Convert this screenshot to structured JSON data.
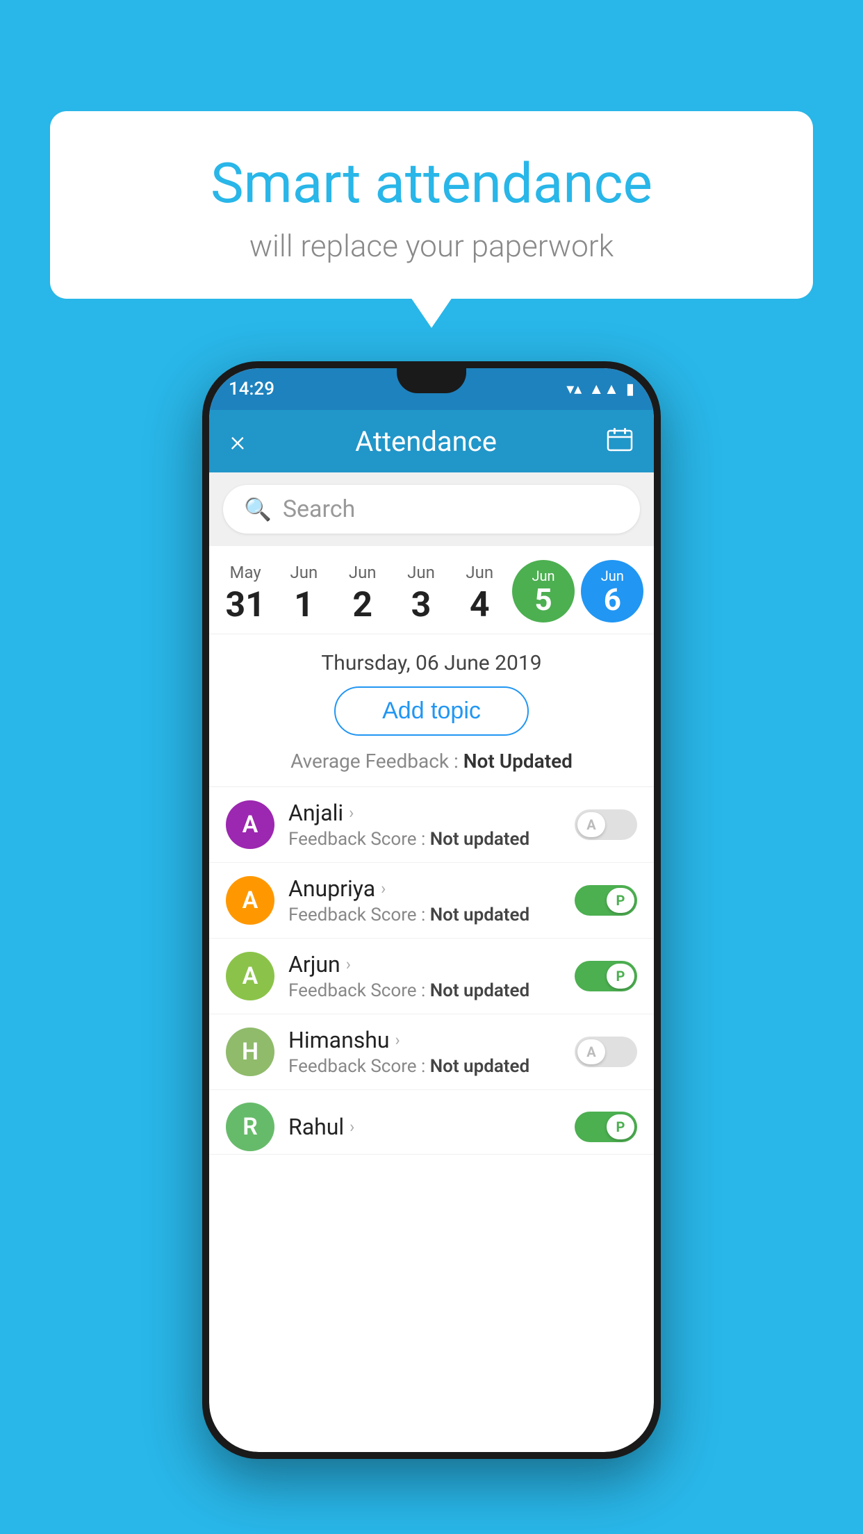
{
  "background_color": "#29B6E8",
  "bubble": {
    "title": "Smart attendance",
    "subtitle": "will replace your paperwork"
  },
  "status_bar": {
    "time": "14:29",
    "wifi_icon": "wifi",
    "signal_icon": "signal",
    "battery_icon": "battery"
  },
  "header": {
    "title": "Attendance",
    "close_icon": "×",
    "calendar_icon": "calendar"
  },
  "search": {
    "placeholder": "Search"
  },
  "dates": [
    {
      "month": "May",
      "day": "31",
      "active": false
    },
    {
      "month": "Jun",
      "day": "1",
      "active": false
    },
    {
      "month": "Jun",
      "day": "2",
      "active": false
    },
    {
      "month": "Jun",
      "day": "3",
      "active": false
    },
    {
      "month": "Jun",
      "day": "4",
      "active": false
    },
    {
      "month": "Jun",
      "day": "5",
      "active": "green"
    },
    {
      "month": "Jun",
      "day": "6",
      "active": "blue"
    }
  ],
  "selected_date_label": "Thursday, 06 June 2019",
  "add_topic_label": "Add topic",
  "avg_feedback_label": "Average Feedback :",
  "avg_feedback_value": "Not Updated",
  "students": [
    {
      "name": "Anjali",
      "avatar_letter": "A",
      "avatar_color": "purple",
      "feedback_label": "Feedback Score :",
      "feedback_value": "Not updated",
      "toggle": "off",
      "toggle_letter": "A"
    },
    {
      "name": "Anupriya",
      "avatar_letter": "A",
      "avatar_color": "orange",
      "feedback_label": "Feedback Score :",
      "feedback_value": "Not updated",
      "toggle": "on",
      "toggle_letter": "P"
    },
    {
      "name": "Arjun",
      "avatar_letter": "A",
      "avatar_color": "green",
      "feedback_label": "Feedback Score :",
      "feedback_value": "Not updated",
      "toggle": "on",
      "toggle_letter": "P"
    },
    {
      "name": "Himanshu",
      "avatar_letter": "H",
      "avatar_color": "sage",
      "feedback_label": "Feedback Score :",
      "feedback_value": "Not updated",
      "toggle": "off",
      "toggle_letter": "A"
    }
  ]
}
